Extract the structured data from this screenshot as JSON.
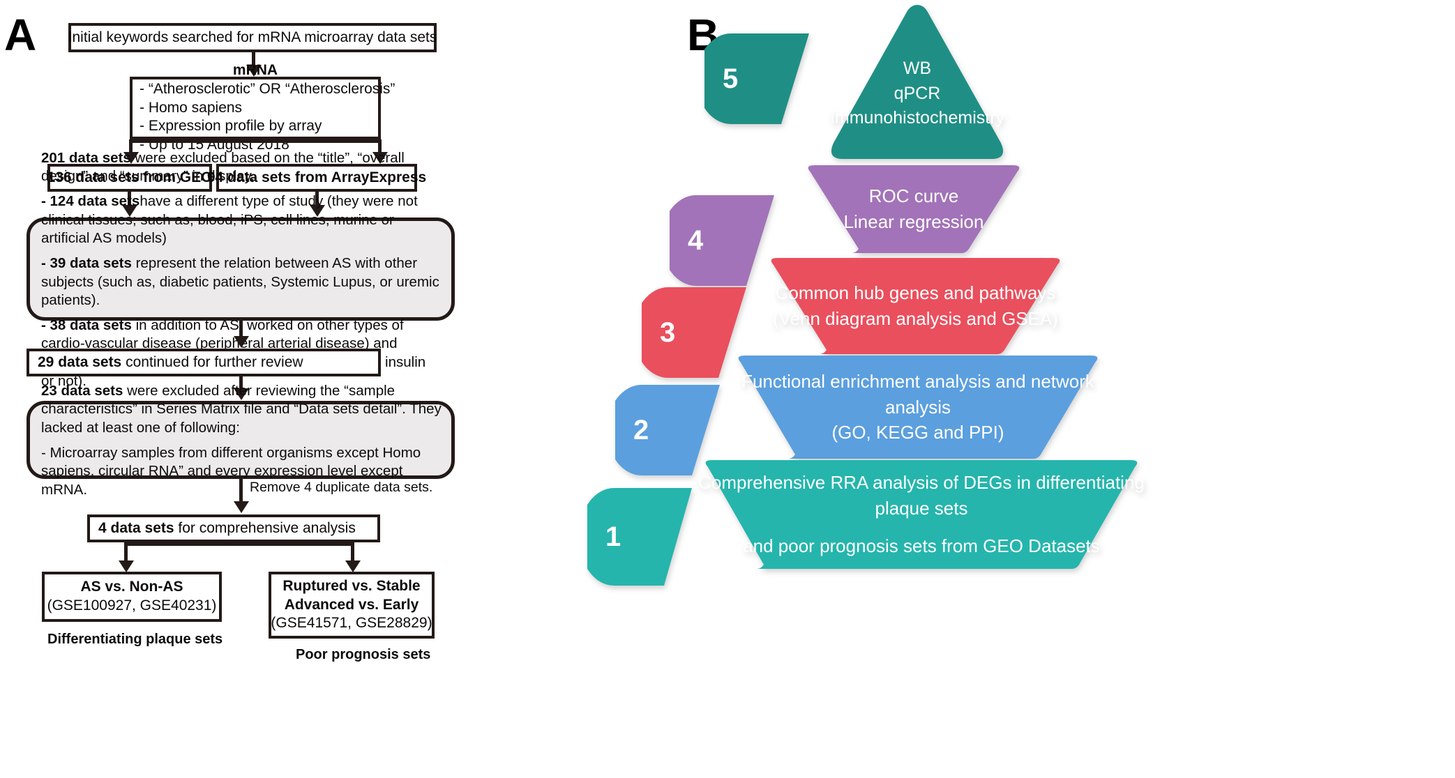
{
  "panels": {
    "a": {
      "letter": "A"
    },
    "b": {
      "letter": "B"
    }
  },
  "flowchart": {
    "title_box": "Initial keywords searched for mRNA microarray data sets",
    "criteria_box": {
      "heading": "mRNA",
      "lines": [
        "- “Atherosclerotic” OR “Atherosclerosis”",
        "- Homo sapiens",
        "- Expression profile by array",
        "- Up to 15 August 2018"
      ]
    },
    "source_geo": "136 data sets from GEO",
    "source_arrayexpress": "94 data sets from ArrayExpress",
    "exclusion_1": {
      "p1_bold": "201 data sets",
      "p1_rest": " were excluded based on the “title”, “overall design” and “summary” in display.",
      "p2_bold": "- 124 data sets",
      "p2_rest": "have a different type of study (they were not clinical tissues; such as, blood, iPS, cell lines, murine or artificial AS models)",
      "p3_bold": "- 39 data sets",
      "p3_rest": " represent the relation between AS with other subjects (such as, diabetic patients, Systemic Lupus, or uremic patients).",
      "p4_bold": "- 38 data sets",
      "p4_rest": " in addition to AS, worked on other types of cardio-vascular disease (peripheral arterial disease) and different experimental design for AS (alcohol abuse or insulin or not)."
    },
    "continued_box": {
      "bold": "29 data sets",
      "rest": " continued for further review"
    },
    "exclusion_2": {
      "p1_bold": "23 data sets",
      "p1_rest": " were excluded after reviewing the “sample characteristics” in Series Matrix file and “Data sets detail”. They lacked at least one of following:",
      "p2": "- Microarray samples from different organisms except Homo sapiens, circular RNA” and every expression level except mRNA."
    },
    "remove_note": "Remove 4 duplicate data sets.",
    "final_box": {
      "bold": "4 data sets",
      "rest": " for comprehensive analysis"
    },
    "outcome_left": {
      "line1": "AS vs. Non-AS",
      "line2": "(GSE100927, GSE40231)",
      "caption": "Differentiating plaque sets"
    },
    "outcome_right": {
      "line1": "Ruptured vs. Stable",
      "line2": "Advanced vs. Early",
      "line3": "(GSE41571, GSE28829)",
      "caption": "Poor prognosis sets"
    }
  },
  "pyramid": {
    "tiers": [
      {
        "number": "5",
        "color": "#1f8f85",
        "lines": [
          "WB",
          "qPCR",
          "Immunohistochemistry"
        ]
      },
      {
        "number": "4",
        "color": "#a273b8",
        "lines": [
          "ROC curve",
          "Linear regression"
        ]
      },
      {
        "number": "3",
        "color": "#ea4f5d",
        "lines": [
          "Common hub genes and pathways",
          "(Venn diagram analysis and GSEA)"
        ]
      },
      {
        "number": "2",
        "color": "#5b9fde",
        "lines": [
          "Functional enrichment analysis and network analysis",
          "(GO, KEGG and PPI)"
        ]
      },
      {
        "number": "1",
        "color": "#25b5ac",
        "lines": [
          "Comprehensive RRA analysis of DEGs in differentiating plaque sets",
          "and poor prognosis sets from GEO Datasets"
        ]
      }
    ]
  }
}
